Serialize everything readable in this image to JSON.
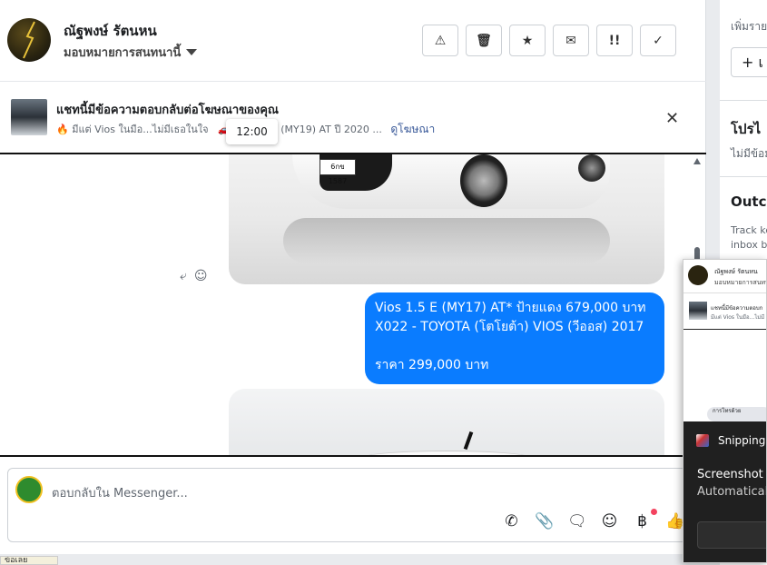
{
  "header": {
    "name": "ณัฐพงษ์ รัตนหน",
    "assign_label": "มอบหมายการสนทนานี้",
    "actions": [
      "⚠",
      "🗑",
      "★",
      "✉",
      "!!",
      "✓"
    ]
  },
  "banner": {
    "title": "แชทนี้มีข้อความตอบกลับต่อโฆษณาของคุณ",
    "subtitle": "มีแต่ Vios ในมือ...ไม่มีเธอในใจ",
    "subtitle_tail": "igh (MY19) AT ปี 2020 ...",
    "view_ad": "ดูโฆษณา",
    "tooltip_time": "12:00"
  },
  "thread": {
    "plate_text": "6กข 1587",
    "message_lines": [
      "Vios 1.5 E (MY17) AT* ป้ายแดง 679,000 บาท",
      "X022 - TOYOTA (โตโยต้า) VIOS (วีออส) 2017",
      "",
      "ราคา 299,000 บาท"
    ]
  },
  "composer": {
    "placeholder": "ตอบกลับใน Messenger..."
  },
  "bottom_tab": {
    "label": "ข้อเลย"
  },
  "right_panel": {
    "add_label": "เพิ่มราย",
    "add_button": "+ เ",
    "promo_title": "โปรไ",
    "promo_sub": "ไม่มีข้อมู",
    "outcome_title": "Outco",
    "outcome_line1": "Track ke",
    "outcome_line2": "inbox b"
  },
  "snip": {
    "mini_name": "ณัฐพงษ์ รัตนหน",
    "mini_assign": "มอบหมายการสนทนา",
    "mini_title": "แชทนี้มีข้อความตอบก",
    "mini_sub": "มีแต่ Vios ในมือ...ไม่มี",
    "mini_bubble": "การโทรด้วย",
    "title": "Snipping T",
    "line1": "Screenshot c",
    "line2": "Automaticall"
  }
}
